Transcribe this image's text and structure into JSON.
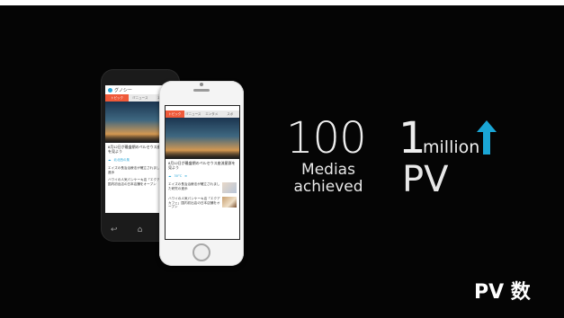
{
  "slide": {
    "stat_medias_value": "100",
    "stat_medias_label_1": "Medias",
    "stat_medias_label_2": "achieved",
    "stat_pv_value": "1",
    "stat_pv_unit": "million",
    "stat_pv_label": "PV",
    "corner_title": "PV 数",
    "arrow_color": "#1aa6d6",
    "accent_color": "#ef5a3a"
  },
  "phone_app": {
    "app_name": "グノシー",
    "tabs": [
      "トピック",
      "ITニュース",
      "エンタメ",
      "スポ"
    ],
    "headline": "8月12日が最盛期のペルセウス座流星群を見よう",
    "meta_weather": "北北西の風",
    "meta_temp": "30°C",
    "article_1": "エイズの長治治療法が確立されました研究の進歩",
    "article_2": "ハワイの人気パンケーキ店「エクアカフェ」国内初出店の日本店舗をオープン"
  }
}
